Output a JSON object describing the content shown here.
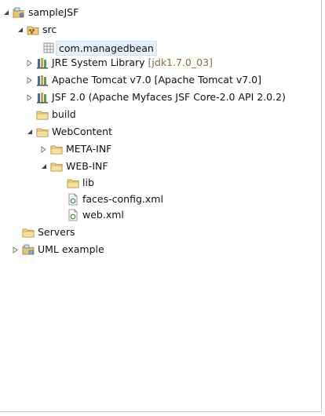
{
  "tree": {
    "project": {
      "label": "sampleJSF",
      "icon": "project-jsf-icon",
      "expanded": true
    },
    "src": {
      "label": "src",
      "icon": "source-folder-icon",
      "expanded": true
    },
    "package": {
      "label": "com.managedbean",
      "icon": "package-icon"
    },
    "jre": {
      "label": "JRE System Library",
      "decoration": "[jdk1.7.0_03]",
      "icon": "library-icon",
      "expanded": false
    },
    "tomcat": {
      "label": "Apache Tomcat v7.0 [Apache Tomcat v7.0]",
      "icon": "library-icon",
      "expanded": false
    },
    "jsf": {
      "label": "JSF 2.0 (Apache Myfaces JSF Core-2.0 API 2.0.2)",
      "icon": "library-icon",
      "expanded": false
    },
    "build": {
      "label": "build",
      "icon": "folder-icon"
    },
    "webcontent": {
      "label": "WebContent",
      "icon": "folder-icon",
      "expanded": true
    },
    "metainf": {
      "label": "META-INF",
      "icon": "folder-icon",
      "expanded": false
    },
    "webinf": {
      "label": "WEB-INF",
      "icon": "folder-icon",
      "expanded": true
    },
    "lib": {
      "label": "lib",
      "icon": "folder-icon"
    },
    "facesconfig": {
      "label": "faces-config.xml",
      "icon": "xml-file-icon"
    },
    "webxml": {
      "label": "web.xml",
      "icon": "xml-file-icon"
    },
    "servers": {
      "label": "Servers",
      "icon": "folder-icon"
    },
    "uml": {
      "label": "UML example",
      "icon": "uml-project-icon",
      "expanded": false
    }
  }
}
